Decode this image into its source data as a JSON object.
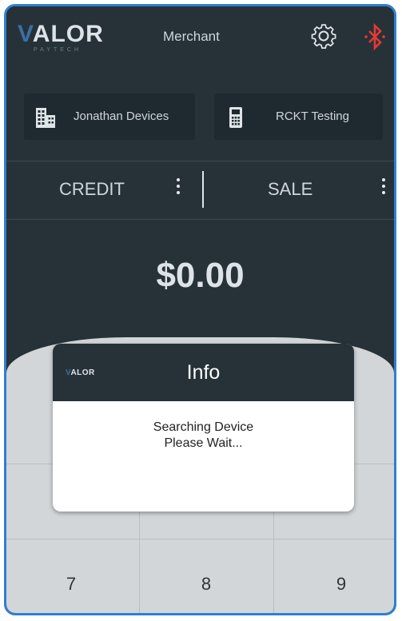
{
  "header": {
    "logo_main": "ALOR",
    "logo_v": "V",
    "logo_sub": "PAYTECH",
    "title": "Merchant",
    "settings_icon": "gear-icon",
    "bluetooth_icon": "bluetooth-icon",
    "bluetooth_color": "#e53935"
  },
  "accounts": [
    {
      "label": "Jonathan Devices",
      "icon": "building-icon"
    },
    {
      "label": "RCKT Testing",
      "icon": "terminal-icon"
    }
  ],
  "transaction": {
    "type": "CREDIT",
    "mode": "SALE"
  },
  "amount": "$0.00",
  "dialog": {
    "logo_v": "V",
    "logo_main": "ALOR",
    "title": "Info",
    "message_line1": "Searching Device",
    "message_line2": "Please Wait..."
  },
  "keypad": {
    "keys": [
      "7",
      "8",
      "9"
    ]
  },
  "colors": {
    "background": "#263238",
    "accent": "#2f7fd1",
    "logo_blue": "#3c6ea5"
  }
}
